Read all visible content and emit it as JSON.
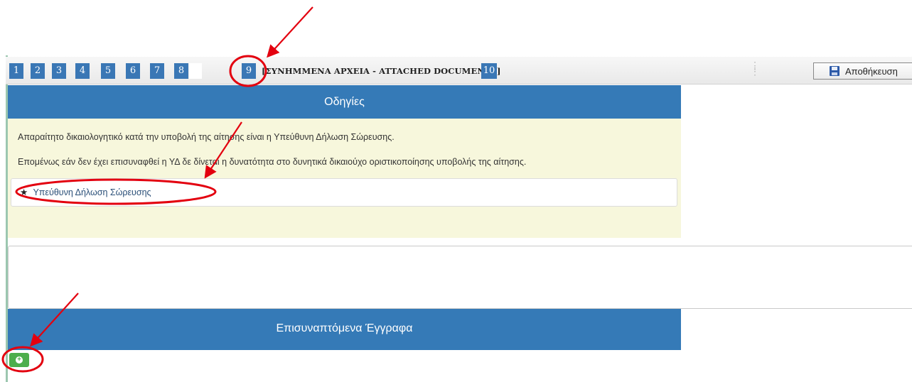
{
  "toolbar": {
    "steps": [
      "1",
      "2",
      "3",
      "4",
      "5",
      "6",
      "7",
      "8",
      "9",
      "10"
    ],
    "active_step_label": "[ΣΥΝΗΜΜΕΝΑ ΑΡΧΕΙΑ - ATTACHED DOCUMENTS]",
    "save_label": "Αποθήκευση",
    "save_icon": "floppy-disk-icon"
  },
  "instructions": {
    "title": "Οδηγίες",
    "line1": "Απαραίτητο δικαιολογητικό κατά την υποβολή της αίτησης είναι η Υπεύθυνη Δήλωση Σώρευσης.",
    "line2": "Επομένως εάν δεν έχει επισυναφθεί η ΥΔ δε δίνεται η δυνατότητα στο δυνητικά δικαιούχο οριστικοποίησης υποβολής της αίτησης.",
    "required_doc": {
      "star": "★",
      "label": "Υπεύθυνη Δήλωση Σώρευσης"
    }
  },
  "notes_field": {
    "value": ""
  },
  "attachments": {
    "title": "Επισυναπτόμενα Έγγραφα",
    "add_icon": "plus-circle-icon"
  },
  "colors": {
    "header_blue": "#357ab7",
    "step_blue": "#3a77b5",
    "instructions_bg": "#f7f7dc",
    "add_button_green": "#4cae4c",
    "annotation_red": "#e3000f"
  }
}
